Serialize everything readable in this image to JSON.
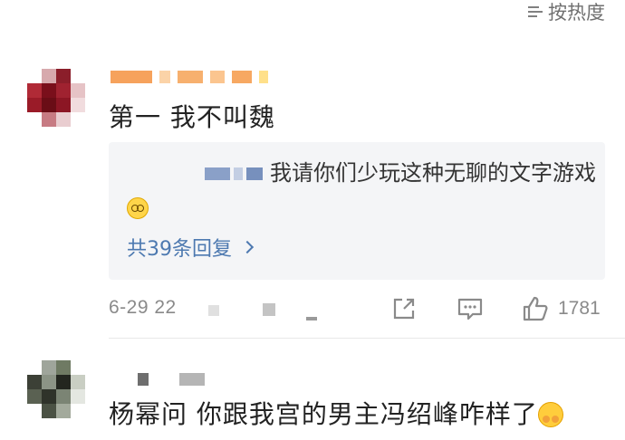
{
  "sort": {
    "label": "按热度",
    "icon": "sort-icon"
  },
  "comments": [
    {
      "text": "第一 我不叫魏",
      "reply_preview": {
        "text": "我请你们少玩这种无聊的文字游戏",
        "emoji": "dizzy-face-emoji",
        "more_label": "共39条回复"
      },
      "timestamp": "6-29 22",
      "like_count": "1781",
      "actions": [
        "share-icon",
        "comment-icon",
        "like-icon"
      ]
    },
    {
      "text": "杨幂问 你跟我宫的男主冯绍峰咋样了",
      "emoji": "hugging-face-emoji"
    }
  ],
  "colors": {
    "link": "#4d79b0",
    "meta_text": "#8a8a8a",
    "reply_background": "#f4f5f7",
    "username_redaction": "#f5a25f"
  }
}
